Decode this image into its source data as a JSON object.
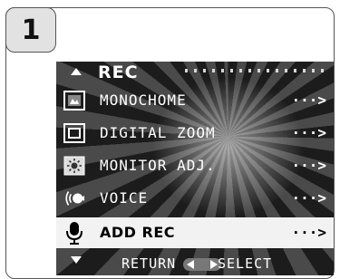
{
  "step_number": "1",
  "menu": {
    "title": "REC",
    "items": [
      {
        "label": "MONOCHOME",
        "icon": "monochrome-icon",
        "arrow": "···>",
        "selected": false
      },
      {
        "label": "DIGITAL ZOOM",
        "icon": "digital-zoom-icon",
        "arrow": "···>",
        "selected": false
      },
      {
        "label": "MONITOR ADJ.",
        "icon": "monitor-adjust-icon",
        "arrow": "···>",
        "selected": false
      },
      {
        "label": "VOICE",
        "icon": "voice-icon",
        "arrow": "···>",
        "selected": false
      },
      {
        "label": "ADD REC",
        "icon": "microphone-icon",
        "arrow": "···>",
        "selected": true
      }
    ]
  },
  "footer": {
    "return_label": "RETURN",
    "select_label": "SELECT"
  },
  "colors": {
    "screen_bg": "#222222",
    "selected_bg": "#f2f2f2",
    "text": "#ffffff",
    "selected_text": "#000000"
  }
}
